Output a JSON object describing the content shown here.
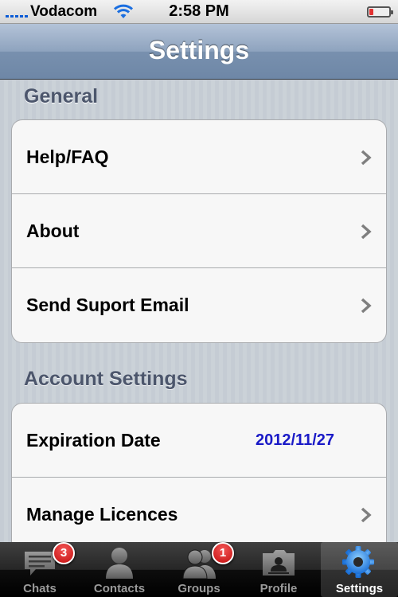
{
  "status_bar": {
    "carrier": "Vodacom",
    "time": "2:58 PM",
    "battery_level": 0.2
  },
  "nav": {
    "title": "Settings"
  },
  "sections": [
    {
      "header": "General",
      "rows": [
        {
          "label": "Help/FAQ",
          "icon": "chevron-right-icon"
        },
        {
          "label": "About",
          "icon": "chevron-right-icon"
        },
        {
          "label": "Send Suport Email",
          "icon": "chevron-right-icon"
        }
      ]
    },
    {
      "header": "Account Settings",
      "rows": [
        {
          "label": "Expiration Date",
          "value": "2012/11/27"
        },
        {
          "label": "Manage Licences",
          "icon": "chevron-right-icon"
        }
      ]
    }
  ],
  "tabs": [
    {
      "label": "Chats",
      "icon": "chat-bubble-icon",
      "badge": "3"
    },
    {
      "label": "Contacts",
      "icon": "person-icon"
    },
    {
      "label": "Groups",
      "icon": "group-icon",
      "badge": "1"
    },
    {
      "label": "Profile",
      "icon": "profile-folder-icon"
    },
    {
      "label": "Settings",
      "icon": "gear-icon",
      "active": true
    }
  ],
  "colors": {
    "accent_value": "#1a1ac7",
    "badge": "#d61a1a",
    "nav": "#7890ae"
  }
}
